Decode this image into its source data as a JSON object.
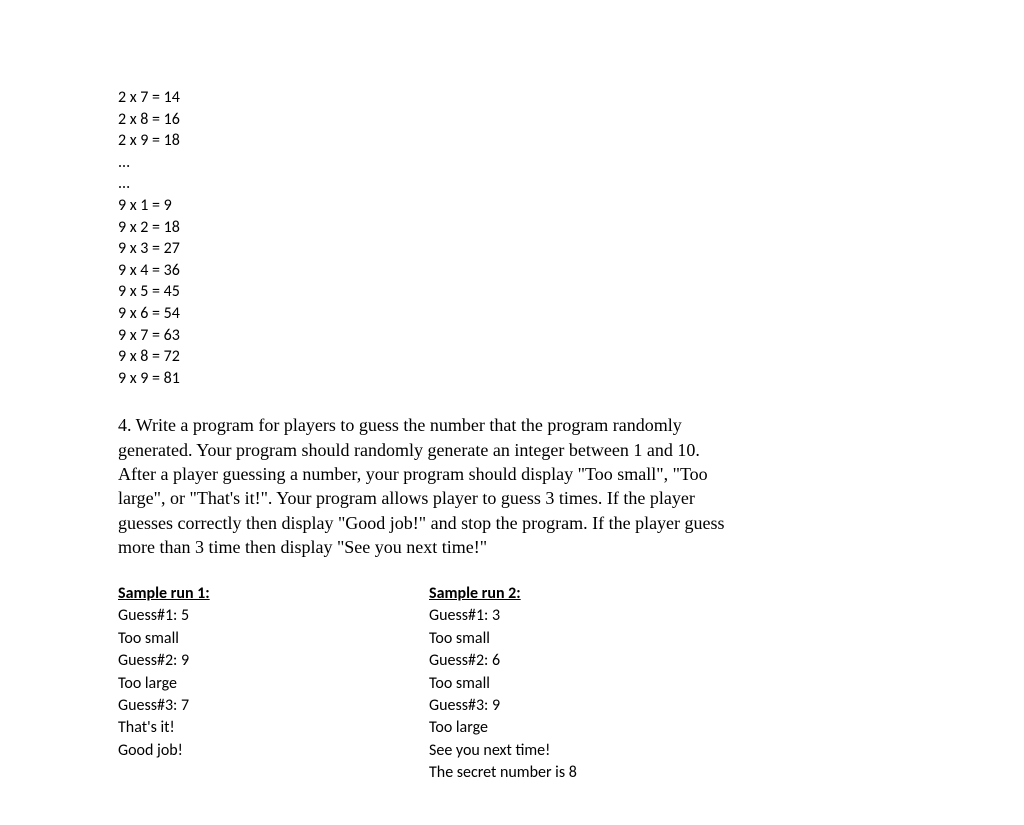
{
  "multLines": [
    "2 x 7 = 14",
    "2 x 8 = 16",
    "2 x 9 = 18",
    "...",
    "...",
    "9 x 1 = 9",
    "9 x 2 = 18",
    "9 x 3 = 27",
    "9 x 4 = 36",
    "9 x 5 = 45",
    "9 x 6 = 54",
    "9 x 7 = 63",
    "9 x 8 = 72",
    "9 x 9 = 81"
  ],
  "question": "4. Write a program for players to guess the number that the program randomly generated. Your program should randomly generate an integer between 1 and 10. After a player guessing a number, your program should display \"Too small\", \"Too large\", or \"That's it!\". Your program allows player to guess 3 times. If the player guesses correctly then display \"Good job!\" and stop the program. If the player guess more than 3 time then display \"See you next time!\"",
  "sample1": {
    "heading": "Sample run 1:",
    "lines": [
      "Guess#1: 5",
      "Too small",
      "Guess#2: 9",
      "Too large",
      "Guess#3: 7",
      "That's it!",
      "Good job!"
    ]
  },
  "sample2": {
    "heading": "Sample run 2:",
    "lines": [
      "Guess#1: 3",
      "Too small",
      "Guess#2: 6",
      "Too small",
      "Guess#3: 9",
      "Too large",
      "See you next time!",
      "The secret number is 8"
    ]
  }
}
